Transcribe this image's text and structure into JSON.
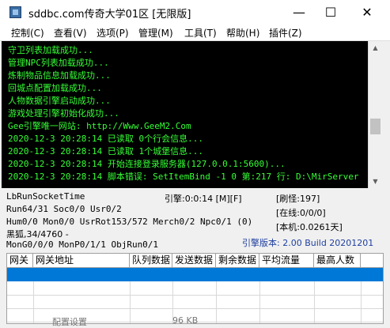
{
  "window": {
    "title": "sddbc.com传奇大学01区 [无限版]",
    "controls": {
      "minimize": "—",
      "maximize": "☐",
      "close": "✕"
    }
  },
  "menu": [
    "控制(C)",
    "查看(V)",
    "选项(P)",
    "管理(M)",
    "工具(T)",
    "帮助(H)",
    "插件(Z)"
  ],
  "console": {
    "lines": [
      {
        "text": "守卫列表加载成功...",
        "color": "#35ff35"
      },
      {
        "text": "管理NPC列表加载成功...",
        "color": "#35ff35"
      },
      {
        "text": "炼制物品信息加载成功...",
        "color": "#35ff35"
      },
      {
        "text": "回城点配置加载成功...",
        "color": "#35ff35"
      },
      {
        "text": "人物数据引擎启动成功...",
        "color": "#35ff35"
      },
      {
        "text": "游戏处理引擎初始化成功...",
        "color": "#35ff35"
      },
      {
        "text": "Gee引擎唯一网站: http://Www.GeeM2.Com",
        "color": "#35ff35"
      },
      {
        "text": "2020-12-3 20:28:14 已读取 0个行会信息...",
        "color": "#35ff35"
      },
      {
        "text": "2020-12-3 20:28:14 已读取 1个城堡信息...",
        "color": "#35ff35"
      },
      {
        "text": "2020-12-3 20:28:14 开始连接登录服务器(127.0.0.1:5600)...",
        "color": "#35ff35"
      },
      {
        "text": "2020-12-3 20:28:14 脚本错误: SetItemBind -1 0 第:217 行: D:\\MirServer",
        "color": "#35ff35"
      }
    ]
  },
  "status": {
    "lb_run_socket_time": "LbRunSocketTime",
    "engine_time": "引擎:0:0:14 [M][F]",
    "refresh_monsters": "[刷怪:197]",
    "run_line": "Run64/31 Soc0/0 Usr0/2",
    "online": "[在线:0/0/0]",
    "hum_line": "Hum0/0 Mon0/0 UsrRot153/572 Merch0/2 Npc0/1 (0)",
    "local_machine": "[本机:0.0261天]",
    "heifox_line": "黑狐,34/4760 -",
    "mongo_line": "MonG0/0/0 MonP0/1/1 ObjRun0/1",
    "engine_version": "引擎版本: 2.00 Build 20201201"
  },
  "gateway_table": {
    "columns": [
      "网关",
      "网关地址",
      "队列数据",
      "发送数据",
      "剩余数据",
      "平均流量",
      "最高人数"
    ]
  },
  "below_window": {
    "left_text": "配置设置",
    "right_text": "96 KB"
  },
  "colors": {
    "console_bg": "#000000",
    "console_text": "#35ff35",
    "selection": "#0078d7",
    "engine_version": "#1e3ea0"
  }
}
